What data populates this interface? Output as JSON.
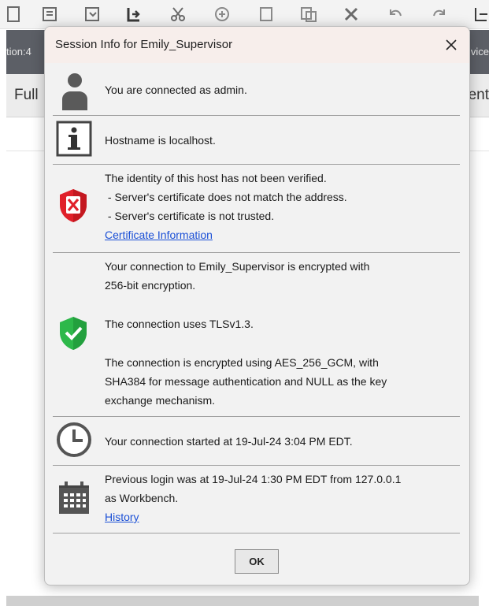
{
  "background": {
    "toolbar_icons": [
      "new-doc-icon",
      "open-icon",
      "new-folder-icon",
      "import-icon",
      "cut-icon",
      "copy-icon",
      "paste-icon",
      "paste-special-icon",
      "delete-icon",
      "undo-icon",
      "redo-icon",
      "export-icon"
    ],
    "status_left": "tion:4",
    "status_right": "vice",
    "tab_left": "Full",
    "tab_right": "ent"
  },
  "dialog": {
    "title": "Session Info for Emily_Supervisor",
    "close_icon": "close-icon",
    "rows": [
      {
        "icon": "user-icon",
        "lines": [
          "You are connected as admin."
        ]
      },
      {
        "icon": "info-icon",
        "lines": [
          "Hostname is localhost."
        ]
      },
      {
        "icon": "shield-error-icon",
        "lines": [
          "The identity of this host has not been verified.",
          " - Server's certificate does not match the address.",
          " - Server's certificate is not trusted."
        ],
        "link": "Certificate Information"
      },
      {
        "icon": "shield-check-icon",
        "lines": [
          "Your connection to Emily_Supervisor is encrypted with",
          "256-bit encryption.",
          "The connection uses TLSv1.3.",
          "The connection is encrypted using AES_256_GCM, with",
          "SHA384 for message authentication and NULL as the key",
          "exchange mechanism."
        ]
      },
      {
        "icon": "clock-icon",
        "lines": [
          "Your connection started at 19-Jul-24 3:04 PM EDT."
        ]
      },
      {
        "icon": "calendar-icon",
        "lines": [
          "Previous login was at 19-Jul-24 1:30 PM EDT from 127.0.0.1",
          "as Workbench."
        ],
        "link": "History"
      }
    ],
    "ok_label": "OK"
  },
  "colors": {
    "shield_error": "#e0202a",
    "shield_ok": "#2db84a",
    "link": "#1a4fd6"
  }
}
